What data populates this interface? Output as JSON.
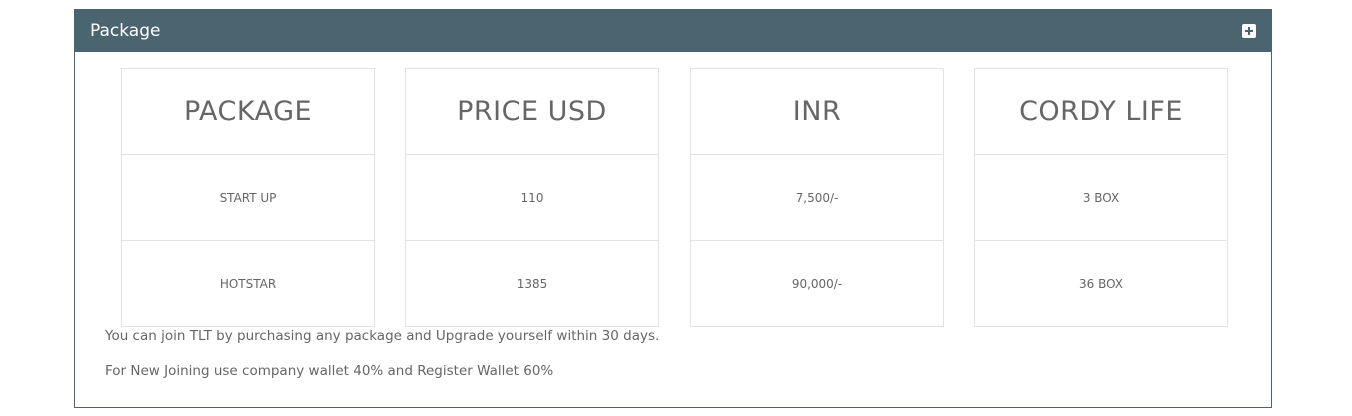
{
  "panel": {
    "title": "Package",
    "expand_icon": "plus-square-icon"
  },
  "table": {
    "headers": [
      "PACKAGE",
      "PRICE USD",
      "INR",
      "CORDY LIFE"
    ],
    "rows": [
      [
        "START UP",
        "110",
        "7,500/-",
        "3 BOX"
      ],
      [
        "HOTSTAR",
        "1385",
        "90,000/-",
        "36 BOX"
      ]
    ]
  },
  "notes": [
    "You can join TLT by purchasing any package and Upgrade yourself within 30 days.",
    "For New Joining use company wallet 40% and Register Wallet 60%"
  ],
  "colors": {
    "header_bg": "#4a6470",
    "border": "#e3e3e3",
    "text": "#666666"
  }
}
